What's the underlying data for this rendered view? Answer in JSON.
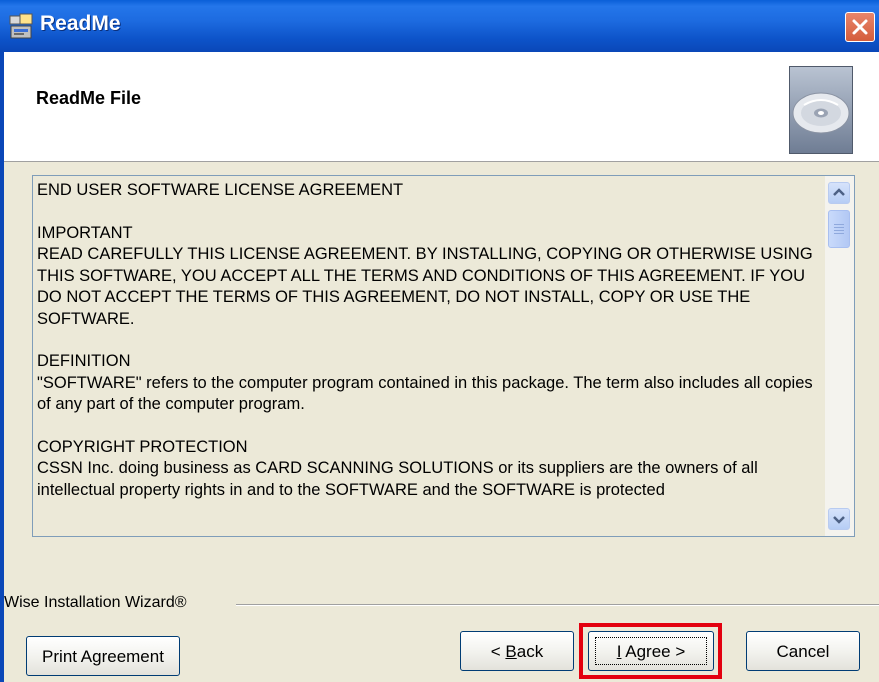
{
  "window": {
    "title": "ReadMe",
    "close_icon": "close-icon"
  },
  "header": {
    "title": "ReadMe File",
    "image_icon": "cd-disc-icon"
  },
  "license": {
    "lines": [
      "END USER SOFTWARE LICENSE AGREEMENT",
      "IMPORTANT",
      "READ CAREFULLY THIS LICENSE AGREEMENT. BY INSTALLING, COPYING OR OTHERWISE USING THIS SOFTWARE, YOU ACCEPT ALL THE TERMS AND CONDITIONS OF THIS AGREEMENT. IF YOU DO NOT ACCEPT THE TERMS OF THIS AGREEMENT, DO NOT INSTALL, COPY OR USE THE SOFTWARE.",
      "DEFINITION",
      "\"SOFTWARE\" refers to the computer program contained in this package. The term also includes all copies of any part of the computer program.",
      "COPYRIGHT PROTECTION",
      "CSSN Inc. doing business as CARD SCANNING SOLUTIONS or its suppliers are the owners of all intellectual property rights in and to the SOFTWARE and the SOFTWARE is protected"
    ]
  },
  "footer": {
    "group_label": "Wise Installation Wizard®",
    "print_label": "Print Agreement",
    "back_prefix": "< ",
    "back_underlined": "B",
    "back_rest": "ack",
    "agree_underlined": "I",
    "agree_rest": " Agree >",
    "cancel_label": "Cancel"
  }
}
